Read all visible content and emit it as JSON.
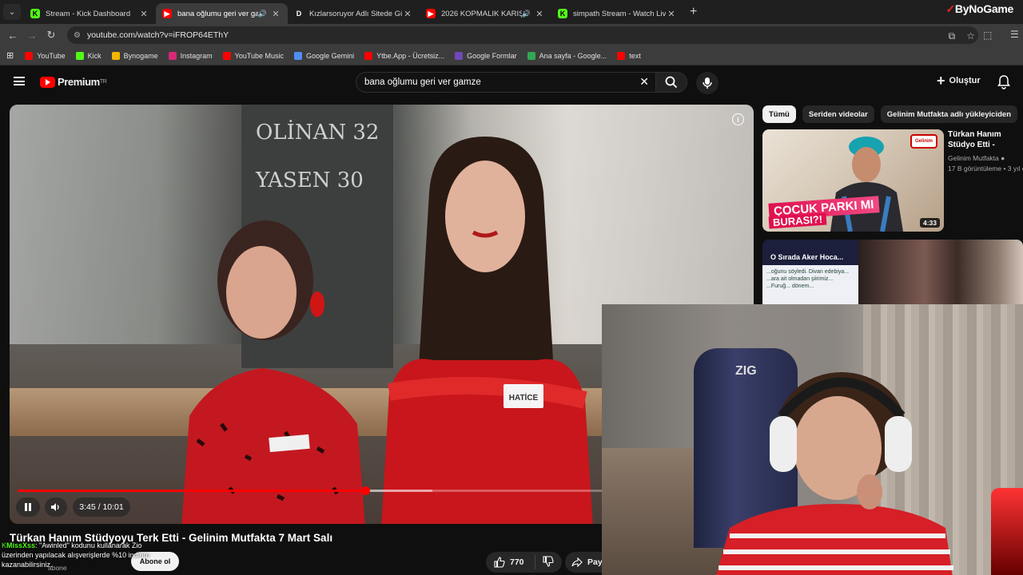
{
  "browser": {
    "tabs": [
      {
        "title": "Stream - Kick Dashboard",
        "favicon_color": "#53fc18",
        "favicon_text": "K",
        "active": false
      },
      {
        "title": "bana oğlumu geri ver gamze",
        "favicon_color": "#ff0000",
        "favicon_text": "▶",
        "active": true
      },
      {
        "title": "Kızlarsoruyor Adlı Sitede Güzel",
        "favicon_color": "#1f1f1f",
        "favicon_text": "D",
        "active": false
      },
      {
        "title": "2026 KOPMALIK KARIŞIK R",
        "favicon_color": "#ff0000",
        "favicon_text": "▶",
        "active": false
      },
      {
        "title": "simpath Stream - Watch Live o",
        "favicon_color": "#53fc18",
        "favicon_text": "K",
        "active": false
      }
    ],
    "brand": {
      "pre": "✓",
      "name": "ByNoGame"
    },
    "url": "youtube.com/watch?v=iFROP64EThY",
    "bookmarks": [
      {
        "label": "YouTube",
        "color": "#ff0000"
      },
      {
        "label": "Kick",
        "color": "#53fc18"
      },
      {
        "label": "Bynogame",
        "color": "#f2b600"
      },
      {
        "label": "Instagram",
        "color": "#d62976"
      },
      {
        "label": "YouTube Music",
        "color": "#ff0000"
      },
      {
        "label": "Google Gemini",
        "color": "#4f8ef7"
      },
      {
        "label": "Ytbe.App - Ücretsiz...",
        "color": "#ff0000"
      },
      {
        "label": "Google Formlar",
        "color": "#7248b9"
      },
      {
        "label": "Ana sayfa - Google...",
        "color": "#34a853"
      },
      {
        "label": "text",
        "color": "#ff0000"
      }
    ]
  },
  "youtube": {
    "logo_text": "Premium",
    "logo_sub": "TR",
    "search_value": "bana oğlumu geri ver gamze",
    "create_label": "Oluştur",
    "player": {
      "time": "3:45 / 10:01",
      "progress": 0.477,
      "buffered": 0.57,
      "board_lines": [
        "OLİNAN 32",
        "YASEN 30"
      ],
      "name_tag": "HATİCE"
    },
    "video_title": "Türkan Hanım Stüdyoyu Terk Etti - Gelinim Mutfakta 7 Mart Salı",
    "channel_subs": "abone",
    "subscribe_label": "Abone ol",
    "likes": "770",
    "share_label": "Pay",
    "chips": [
      "Tümü",
      "Seriden videolar",
      "Gelinim Mutfakta adlı yükleyiciden"
    ],
    "recommendations": [
      {
        "title": "Türkan Hanım Stüdyo Etti - Gelinim Mutfakt",
        "channel": "Gelinim Mutfakta",
        "stats": "17 B görüntüleme • 3 yıl ö",
        "duration": "4:33",
        "caption_line1": "ÇOCUK PARKI MI",
        "caption_line2": "BURASI?!",
        "logo_text": "Gelinim"
      },
      {
        "header": "O Sırada Aker Hoca...",
        "doc_text": "...oğunu söyledi. Divan edebiya... ...ara ait olmadan şiirimiz... ...Furuğ... dönem..."
      }
    ]
  },
  "stream_overlay": {
    "chat_user": "MissXss",
    "chat_message": ": \"Awinled\" kodunu kullanarak Zio",
    "chat_line2": "üzerinden yapılacak alışverişlerde %10 indirim",
    "chat_line3": "kazanabilirsiniz.",
    "webcam_chair_text": "ZIG"
  }
}
